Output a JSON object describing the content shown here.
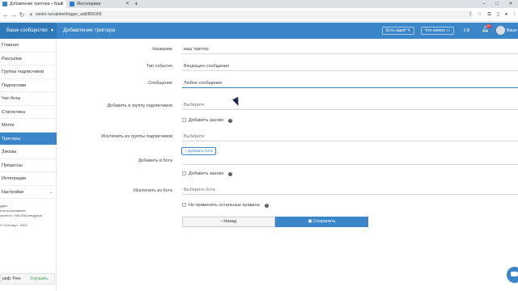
{
  "browser": {
    "tabs": [
      {
        "title": "Добавление триггера « Ваш",
        "active": true,
        "favicon_color": "#3a86c8"
      },
      {
        "title": "Мессенджер",
        "active": false,
        "favicon_color": "#2a7bd1"
      }
    ],
    "new_tab": "+",
    "url": "senler.ru/cabinet/trigger_add/856309",
    "window_controls": {
      "minimize": "–",
      "maximize": "□",
      "close": "✕"
    }
  },
  "header": {
    "brand": "Ваше сообщество",
    "page_title": "Добавление триггера",
    "buttons": [
      "Есть идея!",
      "Что нового"
    ],
    "counter": "0 ₽",
    "notifications_badge": "9+",
    "user_name": "Ваше",
    "accent": "#3a86c8"
  },
  "sidebar": {
    "items": [
      {
        "label": "Главная"
      },
      {
        "label": "Рассылки"
      },
      {
        "label": "Группы подписчиков"
      },
      {
        "label": "Подписчики"
      },
      {
        "label": "Чат-боты"
      },
      {
        "label": "Статистика"
      },
      {
        "label": "Метки"
      },
      {
        "label": "Триггеры",
        "active": true
      },
      {
        "label": "Заказы"
      },
      {
        "label": "Процессы"
      },
      {
        "label": "Интеграции"
      },
      {
        "label": "Настройки",
        "caret": true
      }
    ],
    "footer": [
      "ддел",
      "ила пользования",
      "senler.ru • Мы Мессенджере",
      "© «Сенлер», 2022"
    ],
    "plan_label": "риф: Free",
    "plan_button": "Улучшить"
  },
  "form": {
    "name_label": "Название",
    "name_value": "ваш триггер",
    "event_label": "Тип события",
    "event_value": "Входящее сообщение",
    "message_label": "Сообщение",
    "message_value": "Любое сообщение",
    "add_group_label": "Добавить в группу подписчиков",
    "add_group_placeholder": "Выберите",
    "add_again_1": "Добавить заново",
    "exclude_group_label": "Исключить из группы подписчиков",
    "exclude_group_placeholder": "Выберите",
    "add_bot_button": "Добавить бота",
    "add_bot_label": "Добавить в бота",
    "add_again_2": "Добавить заново",
    "exclude_bot_label": "Исключить из бота",
    "exclude_bot_placeholder": "Выберите бота",
    "no_other_rules": "Не применять остальные правила",
    "help": "?",
    "back_button": "‹ Назад",
    "save_button": "Сохранить"
  }
}
